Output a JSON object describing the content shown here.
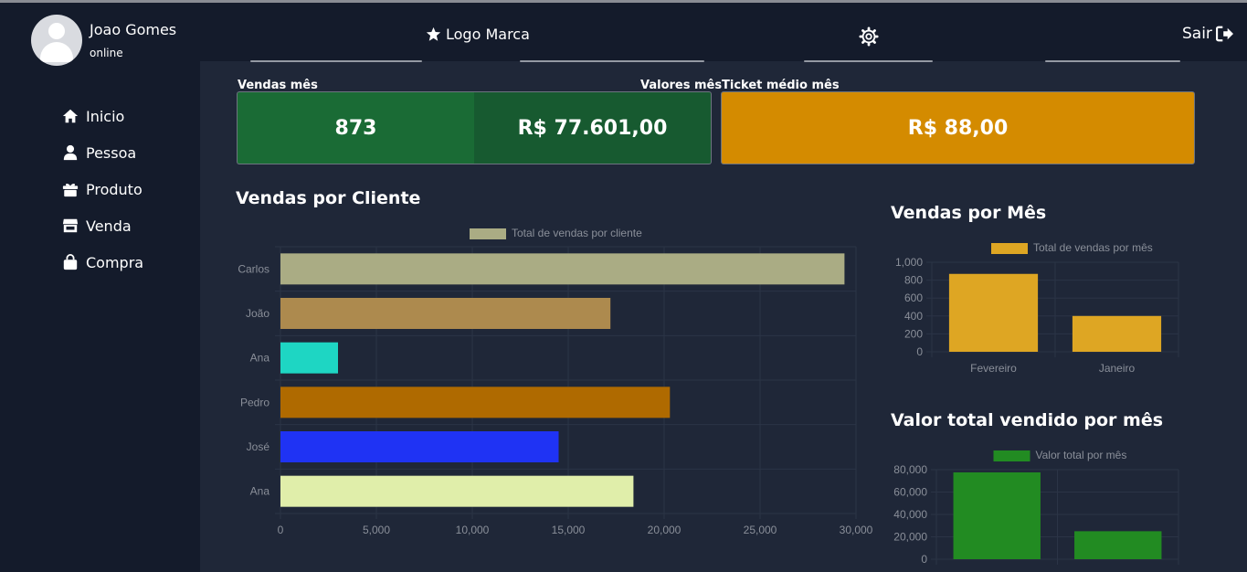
{
  "user": {
    "name": "Joao Gomes",
    "status": "online"
  },
  "nav": [
    {
      "label": "Inicio",
      "icon": "home-icon"
    },
    {
      "label": "Pessoa",
      "icon": "user-icon"
    },
    {
      "label": "Produto",
      "icon": "gift-icon"
    },
    {
      "label": "Venda",
      "icon": "store-icon"
    },
    {
      "label": "Compra",
      "icon": "bag-icon"
    }
  ],
  "header": {
    "brand": "Logo Marca",
    "logout": "Sair"
  },
  "cards": {
    "vendas_label": "Vendas mês",
    "valores_label": "Valores mês",
    "ticket_label": "Ticket médio mês",
    "vendas_value": "873",
    "valores_value": "R$ 77.601,00",
    "ticket_value": "R$ 88,00"
  },
  "colors": {
    "green": "#1a6b35",
    "green_dark": "#175a30",
    "ticket": "#d48b00",
    "bg": "#1f2738",
    "sidebar": "#141b2b"
  },
  "sections": {
    "clientes": "Vendas por Cliente",
    "mes": "Vendas por Mês",
    "valor": "Valor total vendido por mês"
  },
  "chart_data": [
    {
      "type": "bar",
      "orientation": "horizontal",
      "title": "Vendas por Cliente",
      "categories": [
        "Carlos",
        "João",
        "Ana",
        "Pedro",
        "José",
        "Ana"
      ],
      "series": [
        {
          "name": "Total de vendas por cliente",
          "values": [
            29400,
            17200,
            3000,
            20300,
            14500,
            18400
          ]
        }
      ],
      "colors": [
        "#aaac84",
        "#ad8a4e",
        "#1ed6c3",
        "#af6a00",
        "#1f33f4",
        "#e0eeaa"
      ],
      "xlim": [
        0,
        30000
      ],
      "xticks": [
        "0",
        "5,000",
        "10,000",
        "15,000",
        "20,000",
        "25,000",
        "30,000"
      ],
      "grid": true,
      "legend": "top"
    },
    {
      "type": "bar",
      "title": "Vendas por Mês",
      "categories": [
        "Fevereiro",
        "Janeiro"
      ],
      "series": [
        {
          "name": "Total de vendas por mês",
          "values": [
            870,
            400
          ]
        }
      ],
      "colors": [
        "#dea623"
      ],
      "ylim": [
        0,
        1000
      ],
      "yticks": [
        "0",
        "200",
        "400",
        "600",
        "800",
        "1,000"
      ],
      "grid": true,
      "legend": "top"
    },
    {
      "type": "bar",
      "title": "Valor total vendido por mês",
      "categories": [
        "Fevereiro",
        "Janeiro"
      ],
      "series": [
        {
          "name": "Valor total por mês",
          "values": [
            77601,
            25000
          ]
        }
      ],
      "colors": [
        "#228b22"
      ],
      "ylim": [
        0,
        80000
      ],
      "yticks": [
        "0",
        "20,000",
        "40,000",
        "60,000",
        "80,000"
      ],
      "grid": true,
      "legend": "top"
    }
  ]
}
